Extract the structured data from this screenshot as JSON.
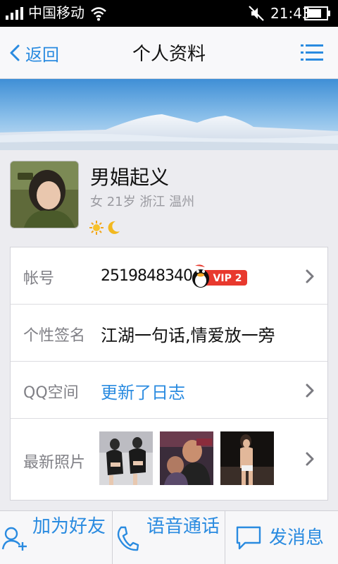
{
  "status_bar": {
    "carrier": "中国移动",
    "time": "21:43"
  },
  "nav": {
    "back_label": "返回",
    "title": "个人资料"
  },
  "profile": {
    "nickname": "男娼起义",
    "meta": "女 21岁 浙江 温州"
  },
  "info": {
    "account_label": "帐号",
    "account_value": "2519848340",
    "vip_label": "VIP 2",
    "signature_label": "个性签名",
    "signature_value": "江湖一句话,情爱放一旁",
    "qzone_label": "QQ空间",
    "qzone_value": "更新了日志",
    "photos_label": "最新照片"
  },
  "actions": {
    "add_friend": "加为好友",
    "voice_call": "语音通话",
    "send_message": "发消息"
  },
  "colors": {
    "accent": "#2a8be0",
    "vip_red": "#e8392e",
    "status_bar": "#000000"
  }
}
